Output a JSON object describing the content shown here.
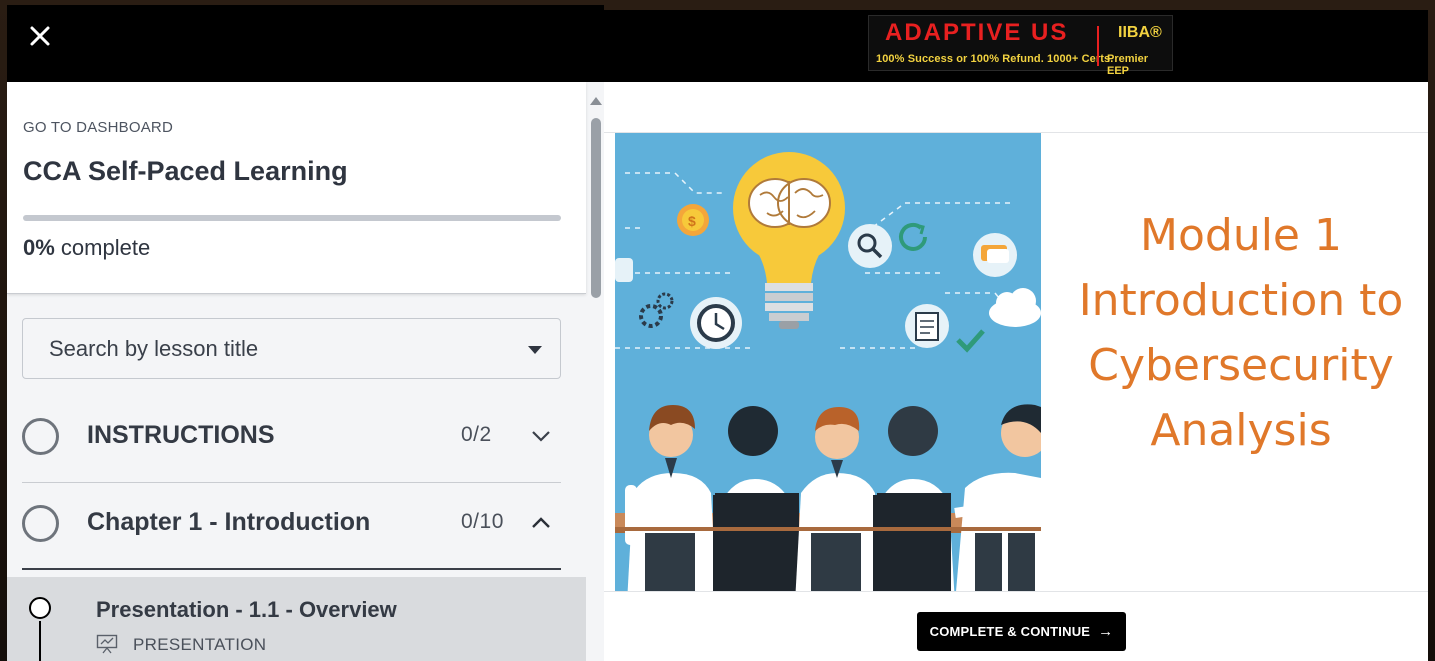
{
  "sidebar": {
    "dashboard_link": "GO TO DASHBOARD",
    "course_title": "CCA Self-Paced Learning",
    "progress_percent": 0,
    "progress_value": "0%",
    "progress_label": " complete",
    "search_placeholder": "Search by lesson title",
    "sections": [
      {
        "title": "INSTRUCTIONS",
        "count": "0/2",
        "expanded": false
      },
      {
        "title": "Chapter 1 - Introduction",
        "count": "0/10",
        "expanded": true
      }
    ],
    "lessons": [
      {
        "title": "Presentation - 1.1 - Overview",
        "type": "PRESENTATION"
      }
    ]
  },
  "header": {
    "logo_main": "ADAPTIVE US",
    "logo_tagline": "100% Success or 100% Refund. 1000+ Certs.",
    "logo_partner": "IIBA®",
    "logo_partner_sub": "Premier EEP"
  },
  "slide": {
    "lines": [
      "Module 1",
      "Introduction to",
      "Cybersecurity",
      "Analysis"
    ]
  },
  "actions": {
    "complete_continue": "COMPLETE & CONTINUE",
    "arrow": "→"
  },
  "colors": {
    "slide_title": "#e0782a",
    "slide_bg": "#5fb0da",
    "logo_red": "#e82020",
    "logo_yellow": "#f2d240"
  }
}
